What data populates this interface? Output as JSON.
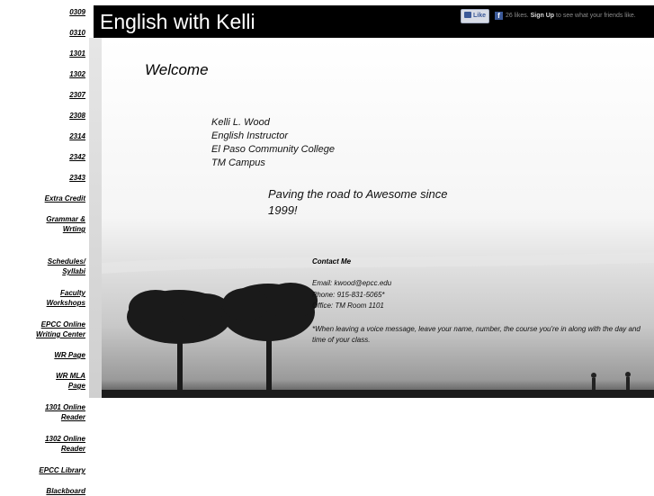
{
  "sidebar": {
    "items": [
      {
        "label": "0309"
      },
      {
        "label": "0310"
      },
      {
        "label": "1301"
      },
      {
        "label": "1302"
      },
      {
        "label": "2307"
      },
      {
        "label": "2308"
      },
      {
        "label": "2314"
      },
      {
        "label": "2342"
      },
      {
        "label": "2343"
      },
      {
        "label": "Extra Credit"
      },
      {
        "label": "Grammar & Wrting"
      },
      {
        "label": "Schedules/ Syllabi"
      },
      {
        "label": "Faculty Workshops"
      },
      {
        "label": "EPCC Online Writing Center"
      },
      {
        "label": "WR Page"
      },
      {
        "label": "WR MLA Page"
      },
      {
        "label": "1301 Online Reader"
      },
      {
        "label": "1302 Online Reader"
      },
      {
        "label": "EPCC Library"
      },
      {
        "label": "Blackboard"
      }
    ]
  },
  "header": {
    "title": "English with Kelli",
    "like_button": "Like",
    "like_count": "26 likes.",
    "signup_link": "Sign Up",
    "signup_suffix": "to see what your friends like."
  },
  "main": {
    "welcome": "Welcome",
    "info_lines": [
      "Kelli L. Wood",
      "English Instructor",
      "El Paso Community College",
      "TM Campus"
    ],
    "tagline_lines": [
      "Paving the road to Awesome since",
      "1999!"
    ],
    "contact_heading": "Contact Me",
    "contact_lines": [
      "Email: kwood@epcc.edu",
      "Phone: 915-831-5065*",
      "Office: TM Room 1101"
    ],
    "note": "*When leaving a voice message, leave your name, number, the course you're in along with the day and time of your class."
  },
  "colors": {
    "header_bg": "#000000",
    "link": "#000000"
  },
  "icons": [
    "thumbs-up-icon",
    "facebook-icon"
  ]
}
